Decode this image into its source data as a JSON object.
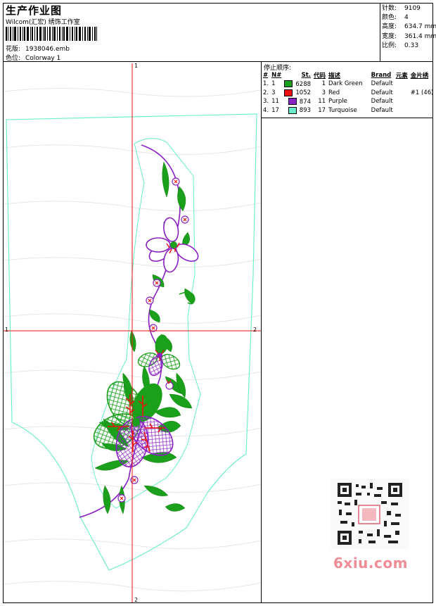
{
  "header": {
    "title": "生产作业图",
    "company": "Wilcom(汇宏) 绣饰工作室",
    "design_file_label": "花版:",
    "design_file": "1938046.emb",
    "colorway_label": "色位:",
    "colorway": "Colorway 1"
  },
  "stats": {
    "stitches_label": "针数:",
    "stitches": "9109",
    "colors_label": "颜色:",
    "colors": "4",
    "height_label": "高度:",
    "height": "634.7 mm",
    "width_label": "宽度:",
    "width": "361.4 mm",
    "scale_label": "比例:",
    "scale": "0.33"
  },
  "sequence": {
    "title": "停止顺序:",
    "headers": [
      "#",
      "N#",
      "St.",
      "代码",
      "描述",
      "Brand",
      "元素",
      "金片绣"
    ],
    "rows": [
      {
        "idx": "1.",
        "n": "1",
        "color": "#1aa01a",
        "st": "6288",
        "code": "1",
        "desc": "Dark Green",
        "brand": "Default",
        "elem": "",
        "seq": ""
      },
      {
        "idx": "2.",
        "n": "3",
        "color": "#ee1111",
        "st": "1052",
        "code": "3",
        "desc": "Red",
        "brand": "Default",
        "elem": "",
        "seq": "#1 (46)"
      },
      {
        "idx": "3.",
        "n": "11",
        "color": "#8a1fc4",
        "st": "874",
        "code": "11",
        "desc": "Purple",
        "brand": "Default",
        "elem": "",
        "seq": ""
      },
      {
        "idx": "4.",
        "n": "17",
        "color": "#66eecc",
        "st": "893",
        "code": "17",
        "desc": "Turquoise",
        "brand": "Default",
        "elem": "",
        "seq": ""
      }
    ]
  },
  "axes": {
    "top": "1",
    "bottom": "2",
    "left": "1",
    "right": "2"
  },
  "watermark": {
    "text": "6xiu.com"
  }
}
